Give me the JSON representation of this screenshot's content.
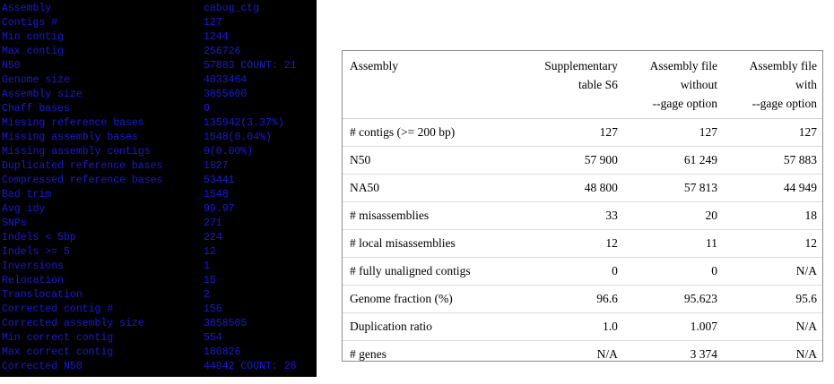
{
  "terminal": {
    "rows": [
      {
        "key": "Assembly",
        "value": "cabog_ctg"
      },
      {
        "key": "Contigs #",
        "value": "127"
      },
      {
        "key": "Min contig",
        "value": "1244"
      },
      {
        "key": "Max contig",
        "value": "256726"
      },
      {
        "key": "N50",
        "value": "57883 COUNT: 21"
      },
      {
        "key": "Genome size",
        "value": "4033464"
      },
      {
        "key": "Assembly size",
        "value": "3855600"
      },
      {
        "key": "Chaff bases",
        "value": "0"
      },
      {
        "key": "Missing reference bases",
        "value": "135942(3.37%)"
      },
      {
        "key": "Missing assembly bases",
        "value": "1548(0.04%)"
      },
      {
        "key": "Missing assembly contigs",
        "value": "0(0.00%)"
      },
      {
        "key": "Duplicated reference bases",
        "value": "1827"
      },
      {
        "key": "Compressed reference bases",
        "value": "53441"
      },
      {
        "key": "Bad trim",
        "value": "1548"
      },
      {
        "key": "Avg idy",
        "value": "99.97"
      },
      {
        "key": "SNPs",
        "value": "271"
      },
      {
        "key": "Indels < 5bp",
        "value": "224"
      },
      {
        "key": "Indels >= 5",
        "value": "12"
      },
      {
        "key": "Inversions",
        "value": "1"
      },
      {
        "key": "Relocation",
        "value": "15"
      },
      {
        "key": "Translocation",
        "value": "2"
      },
      {
        "key": "Corrected contig #",
        "value": "156"
      },
      {
        "key": "Corrected assembly size",
        "value": "3858505"
      },
      {
        "key": "Min correct contig",
        "value": "554"
      },
      {
        "key": "Max correct contig",
        "value": "180826"
      },
      {
        "key": "Corrected N50",
        "value": "44942 COUNT: 26"
      }
    ]
  },
  "table": {
    "headers": [
      [
        "Assembly"
      ],
      [
        "Supplementary",
        "table S6"
      ],
      [
        "Assembly file",
        "without",
        "--gage option"
      ],
      [
        "Assembly file",
        "with",
        "--gage option"
      ]
    ],
    "rows": [
      [
        "# contigs (>= 200 bp)",
        "127",
        "127",
        "127"
      ],
      [
        "N50",
        "57 900",
        "61 249",
        "57 883"
      ],
      [
        "NA50",
        "48 800",
        "57 813",
        "44 949"
      ],
      [
        "# misassemblies",
        "33",
        "20",
        "18"
      ],
      [
        "# local misassemblies",
        "12",
        "11",
        "12"
      ],
      [
        "# fully unaligned contigs",
        "0",
        "0",
        "N/A"
      ],
      [
        "Genome fraction (%)",
        "96.6",
        "95.623",
        "95.6"
      ],
      [
        "Duplication ratio",
        "1.0",
        "1.007",
        "N/A"
      ],
      [
        "# genes",
        "N/A",
        "3 374",
        "N/A"
      ]
    ]
  },
  "colors": {
    "terminal_bg": "#000000",
    "terminal_text": "#1a1ad8",
    "table_border": "#8c8c8c"
  }
}
